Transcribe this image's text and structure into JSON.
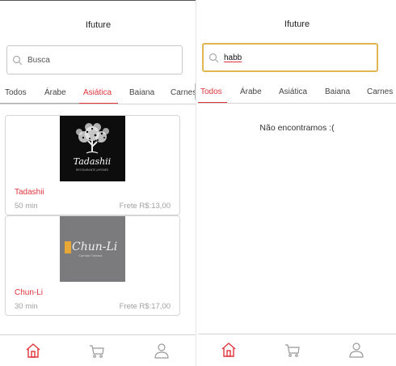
{
  "app_title": "Ifuture",
  "colors": {
    "accent": "#e0343c",
    "search_focus": "#e0b552",
    "muted": "#a0a0a0"
  },
  "icons": {
    "search": "search-icon",
    "home": "home-icon",
    "cart": "cart-icon",
    "profile": "profile-icon"
  },
  "left": {
    "search": {
      "placeholder": "Busca"
    },
    "tabs": [
      {
        "label": "Todos"
      },
      {
        "label": "Árabe"
      },
      {
        "label": "Asiática",
        "active": true
      },
      {
        "label": "Baiana"
      },
      {
        "label": "Carnes"
      }
    ],
    "restaurants": [
      {
        "name": "Tadashii",
        "logo_text": "Tadashii",
        "logo_subtext": "RESTAURANTE JAPONÊS",
        "time": "50 min",
        "fee": "Frete R$:13,00"
      },
      {
        "name": "Chun-Li",
        "logo_text": "Chun-Li",
        "logo_subtext": "Comida Chinesa",
        "time": "30 min",
        "fee": "Frete R$:17,00"
      }
    ]
  },
  "right": {
    "search": {
      "value": "habb"
    },
    "tabs": [
      {
        "label": "Todos",
        "active": true
      },
      {
        "label": "Árabe"
      },
      {
        "label": "Asiática"
      },
      {
        "label": "Baiana"
      },
      {
        "label": "Carnes"
      }
    ],
    "empty_message": "Não encontramos :("
  }
}
